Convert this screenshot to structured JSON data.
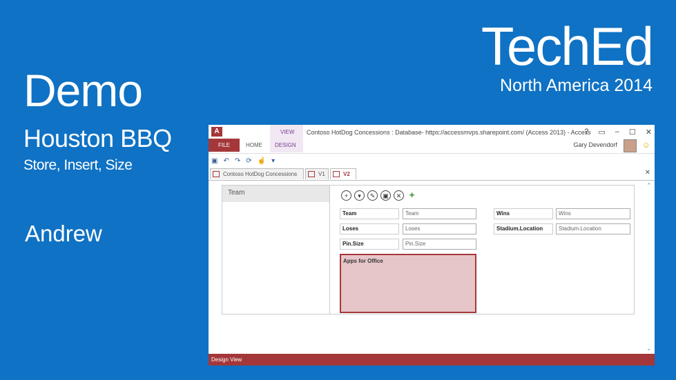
{
  "slide": {
    "title": "Demo",
    "subtitle": "Houston BBQ",
    "subtitle2": "Store, Insert, Size",
    "presenter": "Andrew"
  },
  "brand": {
    "name": "TechEd",
    "subtitle": "North America 2014"
  },
  "app": {
    "window_title": "Contoso HotDog Concessions : Database- https://accessmvps.sharepoint.com/ (Access 2013) - Access",
    "context_tab_group": "VIEW",
    "ribbon_tabs": [
      "FILE",
      "HOME",
      "DESIGN"
    ],
    "user_name": "Gary Devendorf",
    "window_controls": [
      "?",
      "▭",
      "–",
      "☐",
      "✕"
    ],
    "doc_tabs": [
      "Contoso HotDog Concessions",
      "V1",
      "V2"
    ],
    "list_items": [
      "Team"
    ],
    "fields": {
      "team_label": "Team",
      "team_value": "Team",
      "wins_label": "Wins",
      "wins_value": "Wins",
      "loses_label": "Loses",
      "loses_value": "Loses",
      "stadium_label": "Stadium.Location",
      "stadium_value": "Stadium.Location",
      "pinsize_label": "Pin.Size",
      "pinsize_value": "Pin.Size"
    },
    "webpart_label": "Apps for Office",
    "status_text": "Design View",
    "colors": {
      "accent": "#a4373a",
      "slide_bg": "#0f72c4",
      "webpart_fill": "#e6c6c8"
    }
  }
}
